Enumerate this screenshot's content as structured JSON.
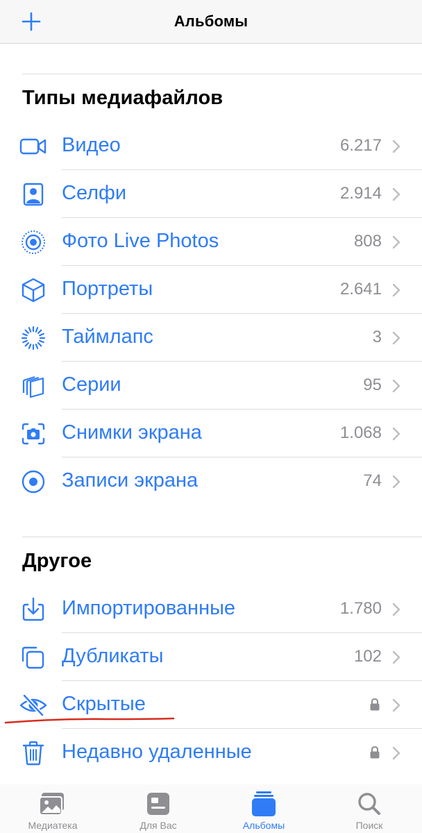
{
  "colors": {
    "accent": "#2f7cf6",
    "secondary": "#8e8e93",
    "annotation": "#d62d1f"
  },
  "navbar": {
    "title": "Альбомы",
    "add_icon": "plus-icon"
  },
  "media_types": {
    "title": "Типы медиафайлов",
    "items": [
      {
        "label": "Видео",
        "count": "6.217",
        "icon": "video-icon"
      },
      {
        "label": "Селфи",
        "count": "2.914",
        "icon": "selfie-icon"
      },
      {
        "label": "Фото Live Photos",
        "count": "808",
        "icon": "live-photo-icon"
      },
      {
        "label": "Портреты",
        "count": "2.641",
        "icon": "cube-icon"
      },
      {
        "label": "Таймлапс",
        "count": "3",
        "icon": "timelapse-icon"
      },
      {
        "label": "Серии",
        "count": "95",
        "icon": "burst-icon"
      },
      {
        "label": "Снимки экрана",
        "count": "1.068",
        "icon": "screenshot-icon"
      },
      {
        "label": "Записи экрана",
        "count": "74",
        "icon": "screen-record-icon"
      }
    ]
  },
  "other": {
    "title": "Другое",
    "items": [
      {
        "label": "Импортированные",
        "count": "1.780",
        "icon": "import-icon"
      },
      {
        "label": "Дубликаты",
        "count": "102",
        "icon": "duplicates-icon"
      },
      {
        "label": "Скрытые",
        "locked": true,
        "icon": "eye-slash-icon"
      },
      {
        "label": "Недавно удаленные",
        "locked": true,
        "icon": "trash-icon"
      }
    ]
  },
  "tabbar": {
    "active": "Альбомы",
    "tabs": [
      {
        "label": "Медиатека",
        "icon": "photos-library-icon"
      },
      {
        "label": "Для Вас",
        "icon": "for-you-icon"
      },
      {
        "label": "Альбомы",
        "icon": "albums-icon"
      },
      {
        "label": "Поиск",
        "icon": "search-icon"
      }
    ]
  }
}
